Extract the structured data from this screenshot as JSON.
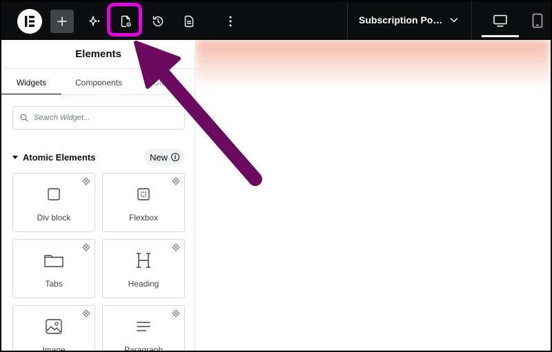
{
  "topbar": {
    "document_title": "Subscription Pop...",
    "icons": {
      "logo": "elementor-logo-icon",
      "add": "plus-icon",
      "ai": "sparkle-icon",
      "page_settings": "page-settings-icon",
      "history": "history-icon",
      "structure": "structure-icon",
      "more": "more-vertical-icon",
      "chevron": "chevron-down-icon",
      "desktop": "desktop-icon",
      "tablet": "tablet-icon"
    }
  },
  "panel": {
    "title": "Elements",
    "tabs": [
      {
        "label": "Widgets"
      },
      {
        "label": "Components"
      },
      {
        "label": "Glo"
      }
    ],
    "search": {
      "placeholder": "Search Widget..."
    },
    "section": {
      "title": "Atomic Elements",
      "badge": "New"
    },
    "widgets": [
      {
        "label": "Div block",
        "icon": "div-block-icon"
      },
      {
        "label": "Flexbox",
        "icon": "flexbox-icon"
      },
      {
        "label": "Tabs",
        "icon": "tabs-icon"
      },
      {
        "label": "Heading",
        "icon": "heading-icon"
      },
      {
        "label": "Image",
        "icon": "image-icon"
      },
      {
        "label": "Paragraph",
        "icon": "paragraph-icon"
      }
    ]
  },
  "colors": {
    "topbar_bg": "#0c0d0e",
    "highlight": "#e600e6",
    "arrow": "#6b0a5e"
  }
}
